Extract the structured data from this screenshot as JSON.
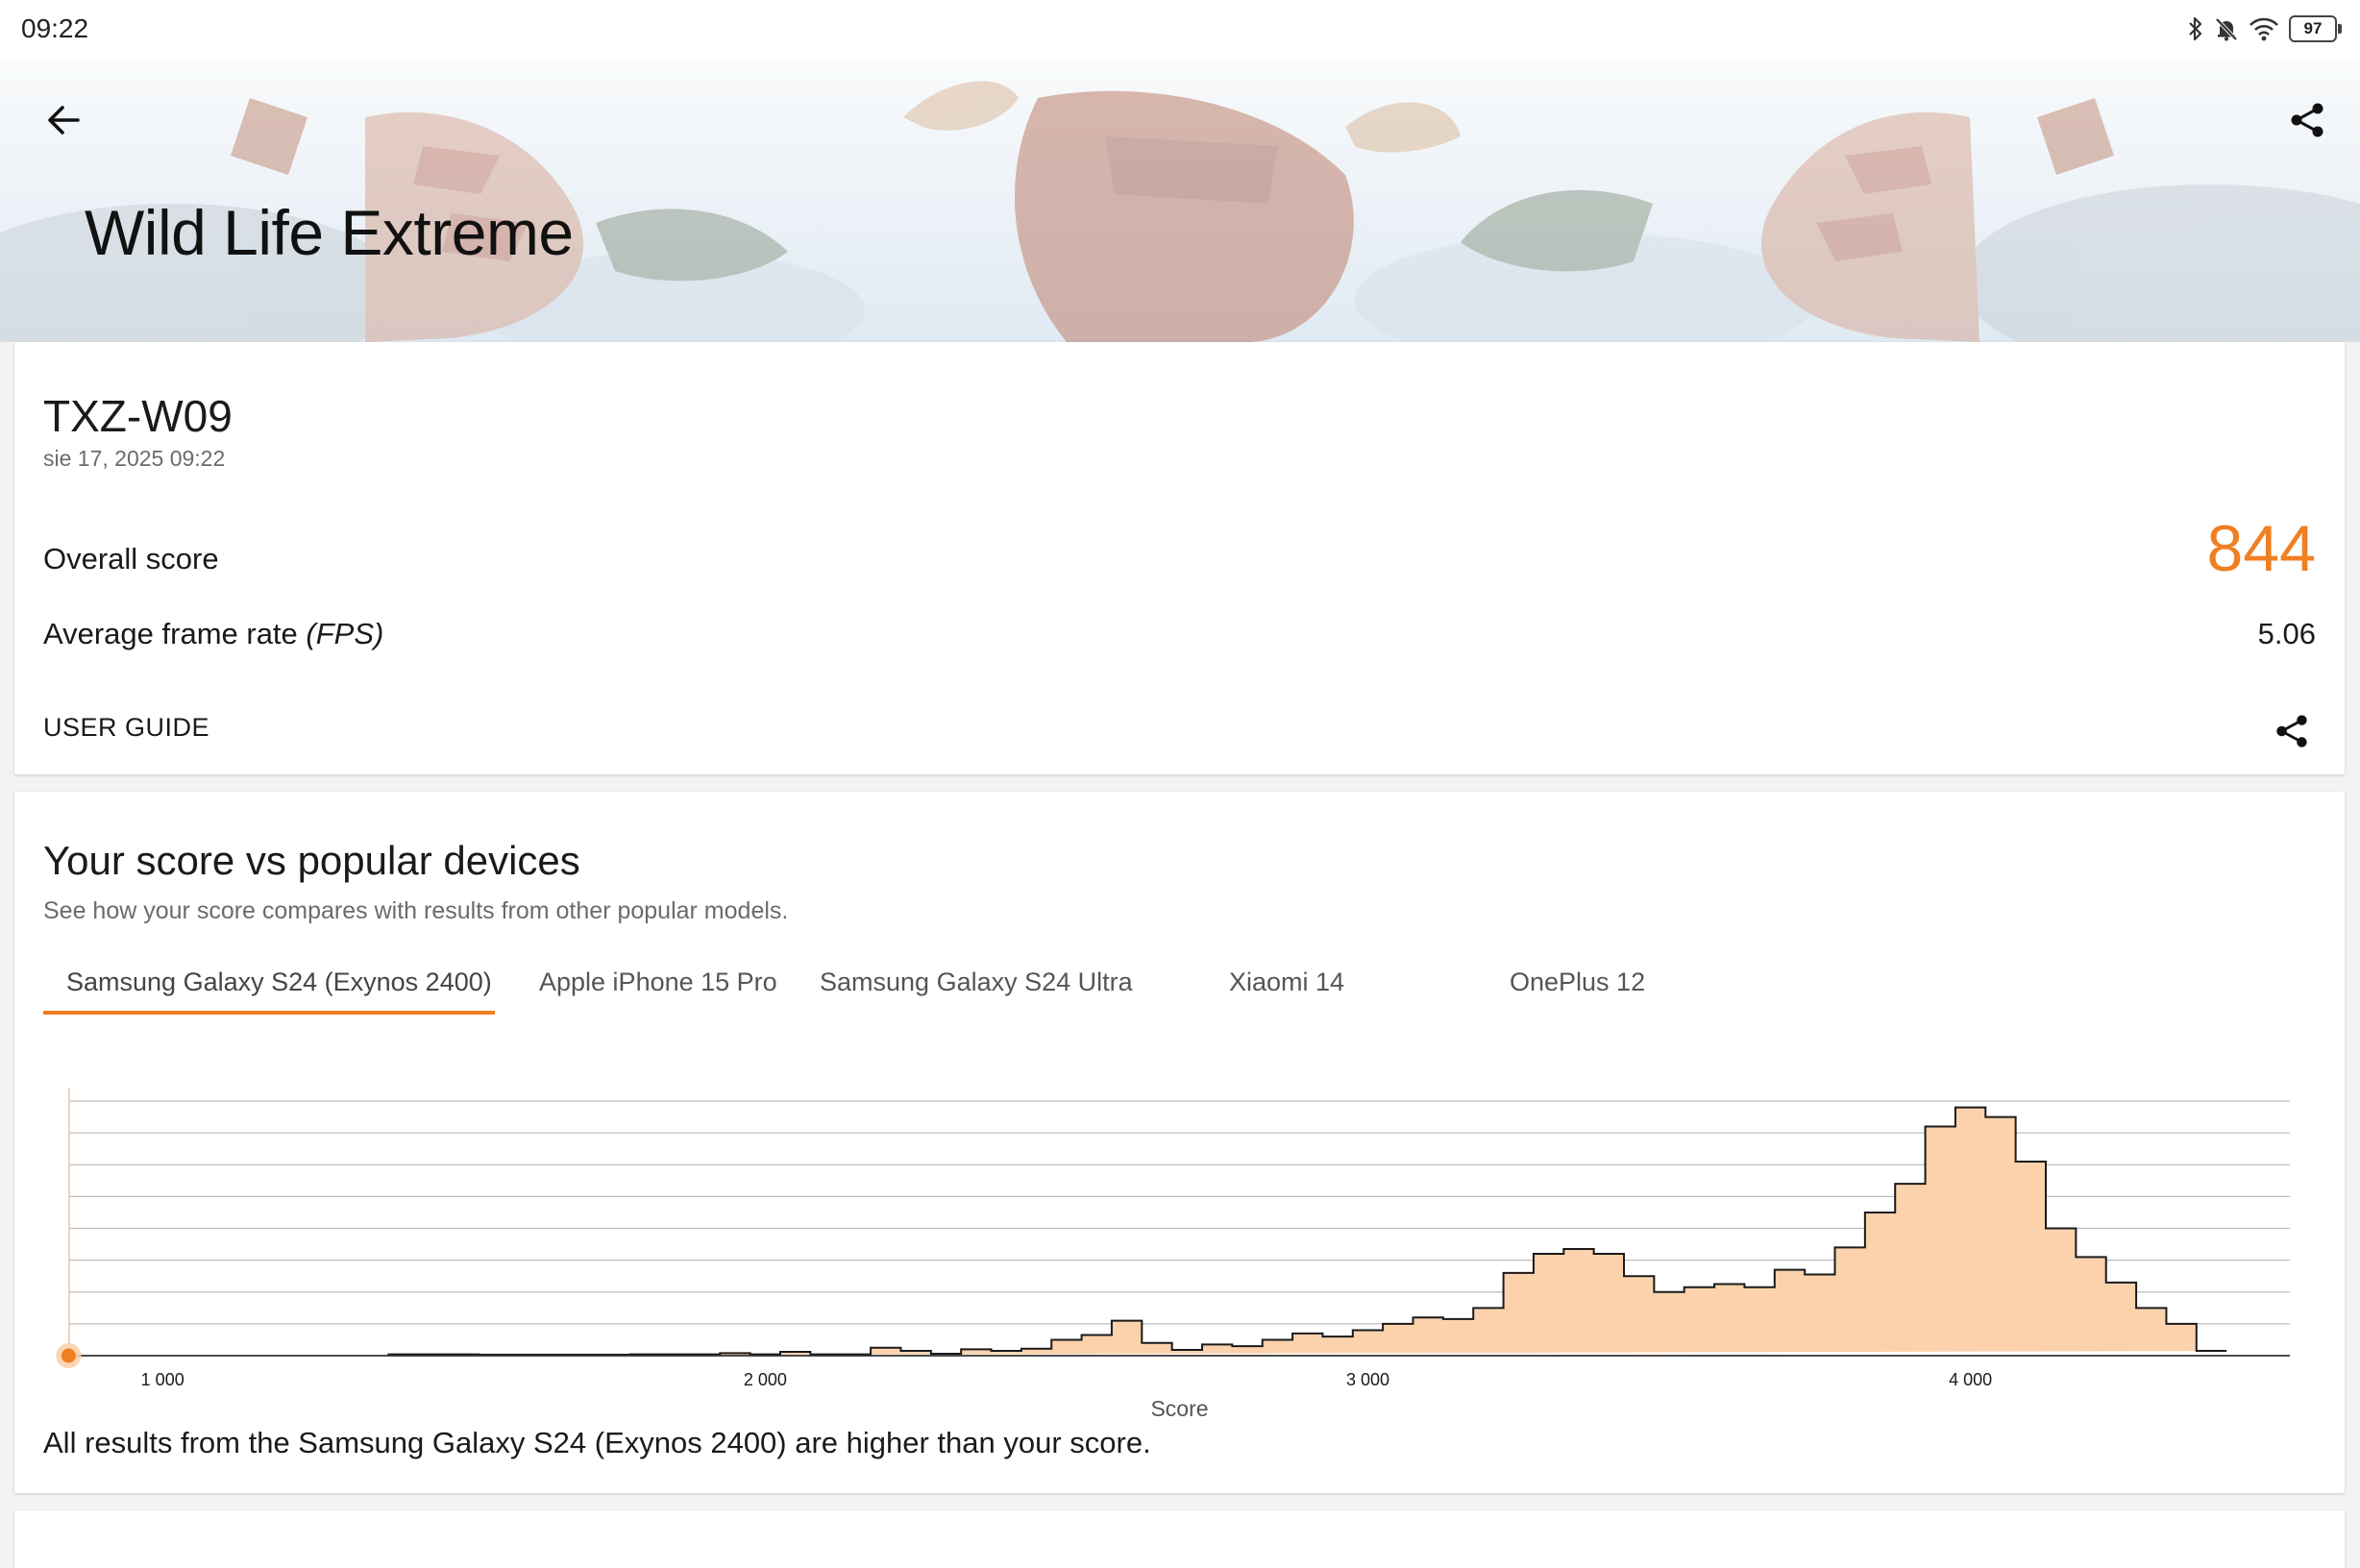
{
  "status": {
    "time": "09:22",
    "battery": "97",
    "icons": [
      "bluetooth-icon",
      "mute-bell-icon",
      "wifi-icon",
      "battery-icon"
    ]
  },
  "header": {
    "title": "Wild Life Extreme",
    "back_icon": "arrow-left-icon",
    "share_icon": "share-icon"
  },
  "result": {
    "device": "TXZ-W09",
    "date": "sie 17, 2025 09:22",
    "overall_label": "Overall score",
    "overall_value": "844",
    "fps_label": "Average frame rate ",
    "fps_unit": "(FPS)",
    "fps_value": "5.06",
    "guide_label": "USER GUIDE"
  },
  "comparison": {
    "title": "Your score vs popular devices",
    "subtitle": "See how your score compares with results from other popular models.",
    "tabs": [
      "Samsung Galaxy S24 (Exynos 2400)",
      "Apple iPhone 15 Pro",
      "Samsung Galaxy S24 Ultra",
      "Xiaomi 14",
      "OnePlus 12"
    ],
    "active_tab": 0,
    "verdict": "All results from the Samsung Galaxy S24 (Exynos 2400) are higher than your score."
  },
  "colors": {
    "accent": "#f07f22",
    "histogram_fill": "#fcd2ac",
    "histogram_stroke": "#1a1a1a",
    "grid": "#bdbdbd"
  },
  "chart_data": {
    "type": "area",
    "xlabel": "Score",
    "ylabel": "",
    "xlim": [
      845,
      4530
    ],
    "ylim": [
      0,
      8
    ],
    "xticks": [
      1000,
      2000,
      3000,
      4000
    ],
    "xtick_labels": [
      "1 000",
      "2 000",
      "3 000",
      "4 000"
    ],
    "grid": true,
    "bin_width": 50,
    "bin_starts": [
      1375,
      1425,
      1475,
      1525,
      1575,
      1625,
      1675,
      1725,
      1775,
      1825,
      1875,
      1925,
      1975,
      2025,
      2075,
      2125,
      2175,
      2225,
      2275,
      2325,
      2375,
      2425,
      2475,
      2525,
      2575,
      2625,
      2675,
      2725,
      2775,
      2825,
      2875,
      2925,
      2975,
      3025,
      3075,
      3125,
      3175,
      3225,
      3275,
      3325,
      3375,
      3425,
      3475,
      3525,
      3575,
      3625,
      3675,
      3725,
      3775,
      3825,
      3875,
      3925,
      3975,
      4025,
      4075,
      4125,
      4175,
      4225,
      4275,
      4325,
      4375,
      4425,
      4475
    ],
    "densities": [
      0.04,
      0.04,
      0.04,
      0.03,
      0.03,
      0.03,
      0.03,
      0.03,
      0.04,
      0.04,
      0.04,
      0.08,
      0.04,
      0.12,
      0.04,
      0.04,
      0.25,
      0.15,
      0.06,
      0.2,
      0.15,
      0.22,
      0.5,
      0.65,
      1.1,
      0.4,
      0.18,
      0.35,
      0.3,
      0.5,
      0.7,
      0.6,
      0.8,
      1.0,
      1.2,
      1.15,
      1.5,
      2.6,
      3.2,
      3.35,
      3.2,
      2.5,
      2.0,
      2.15,
      2.25,
      2.15,
      2.7,
      2.55,
      3.4,
      4.5,
      5.4,
      7.2,
      7.8,
      7.5,
      6.1,
      4.0,
      3.1,
      2.3,
      1.5,
      1.0,
      0.15
    ],
    "your_score": 844
  }
}
